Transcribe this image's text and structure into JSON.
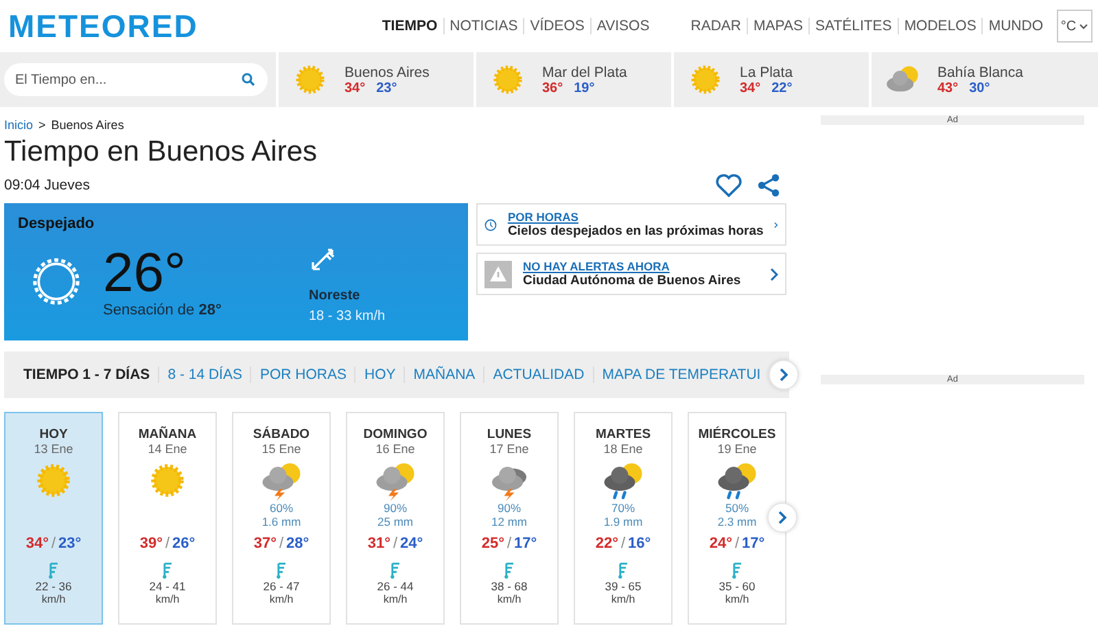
{
  "header": {
    "logo": "METEORED",
    "nav_main": [
      {
        "label": "TIEMPO",
        "selected": true
      },
      {
        "label": "NOTICIAS",
        "selected": false
      },
      {
        "label": "VÍDEOS",
        "selected": false
      },
      {
        "label": "AVISOS",
        "selected": false
      }
    ],
    "nav_tools": [
      {
        "label": "RADAR",
        "selected": false
      },
      {
        "label": "MAPAS",
        "selected": false
      },
      {
        "label": "SATÉLITES",
        "selected": false
      },
      {
        "label": "MODELOS",
        "selected": false
      },
      {
        "label": "MUNDO",
        "selected": false
      }
    ],
    "unit_select": {
      "value": "°C"
    }
  },
  "city_bar": {
    "search": {
      "placeholder": "El Tiempo en..."
    },
    "cities": [
      {
        "name": "Buenos Aires",
        "kind": "sun",
        "max": "34°",
        "min": "23°"
      },
      {
        "name": "Mar del Plata",
        "kind": "sun",
        "max": "36°",
        "min": "19°"
      },
      {
        "name": "La Plata",
        "kind": "sun",
        "max": "34°",
        "min": "22°"
      },
      {
        "name": "Bahía Blanca",
        "kind": "cloud-sun",
        "max": "43°",
        "min": "30°"
      }
    ]
  },
  "breadcrumb": {
    "items": [
      "Inicio",
      "Buenos Aires"
    ],
    "separator": ">"
  },
  "title": "Tiempo en Buenos Aires",
  "time": "09:04 Jueves",
  "current": {
    "condition": "Despejado",
    "temperature": "26°",
    "feels_like": "Sensación de **28°**",
    "wind_direction": "Noreste",
    "wind_speed": "18 - 33 km/h"
  },
  "info_cards": [
    {
      "kind": "clock",
      "link": "POR HORAS",
      "text": "Cielos despejados en las próximas horas"
    },
    {
      "kind": "alert",
      "link": "NO HAY ALERTAS AHORA",
      "text": "Ciudad Autónoma de Buenos Aires"
    }
  ],
  "tabs": [
    {
      "label": "TIEMPO 1 - 7 DÍAS",
      "selected": true
    },
    {
      "label": "8 - 14 DÍAS",
      "selected": false
    },
    {
      "label": "POR HORAS",
      "selected": false
    },
    {
      "label": "HOY",
      "selected": false
    },
    {
      "label": "MAÑANA",
      "selected": false
    },
    {
      "label": "ACTUALIDAD",
      "selected": false
    },
    {
      "label": "MAPA DE TEMPERATUI",
      "selected": false
    }
  ],
  "temp_separator": "/",
  "days": [
    {
      "day": "HOY",
      "date": "13 Ene",
      "kind": "sun",
      "selected": true,
      "max": "34°",
      "min": "23°",
      "wind": "22 - 36",
      "wind_unit": "km/h"
    },
    {
      "day": "MAÑANA",
      "date": "14 Ene",
      "kind": "sun",
      "selected": false,
      "max": "39°",
      "min": "26°",
      "wind": "24 - 41",
      "wind_unit": "km/h"
    },
    {
      "day": "SÁBADO",
      "date": "15 Ene",
      "kind": "storm-sun",
      "selected": false,
      "precip_prob": "60%",
      "precip_amount": "1.6 mm",
      "max": "37°",
      "min": "28°",
      "wind": "26 - 47",
      "wind_unit": "km/h"
    },
    {
      "day": "DOMINGO",
      "date": "16 Ene",
      "kind": "storm-sun",
      "selected": false,
      "precip_prob": "90%",
      "precip_amount": "25 mm",
      "max": "31°",
      "min": "24°",
      "wind": "26 - 44",
      "wind_unit": "km/h"
    },
    {
      "day": "LUNES",
      "date": "17 Ene",
      "kind": "storm",
      "selected": false,
      "precip_prob": "90%",
      "precip_amount": "12 mm",
      "max": "25°",
      "min": "17°",
      "wind": "38 - 68",
      "wind_unit": "km/h"
    },
    {
      "day": "MARTES",
      "date": "18 Ene",
      "kind": "rain-sun",
      "selected": false,
      "precip_prob": "70%",
      "precip_amount": "1.9 mm",
      "max": "22°",
      "min": "16°",
      "wind": "39 - 65",
      "wind_unit": "km/h"
    },
    {
      "day": "MIÉRCOLES",
      "date": "19 Ene",
      "kind": "rain-sun",
      "selected": false,
      "precip_prob": "50%",
      "precip_amount": "2.3 mm",
      "max": "24°",
      "min": "17°",
      "wind": "35 - 60",
      "wind_unit": "km/h"
    }
  ],
  "ads": [
    "Ad",
    "Ad"
  ]
}
